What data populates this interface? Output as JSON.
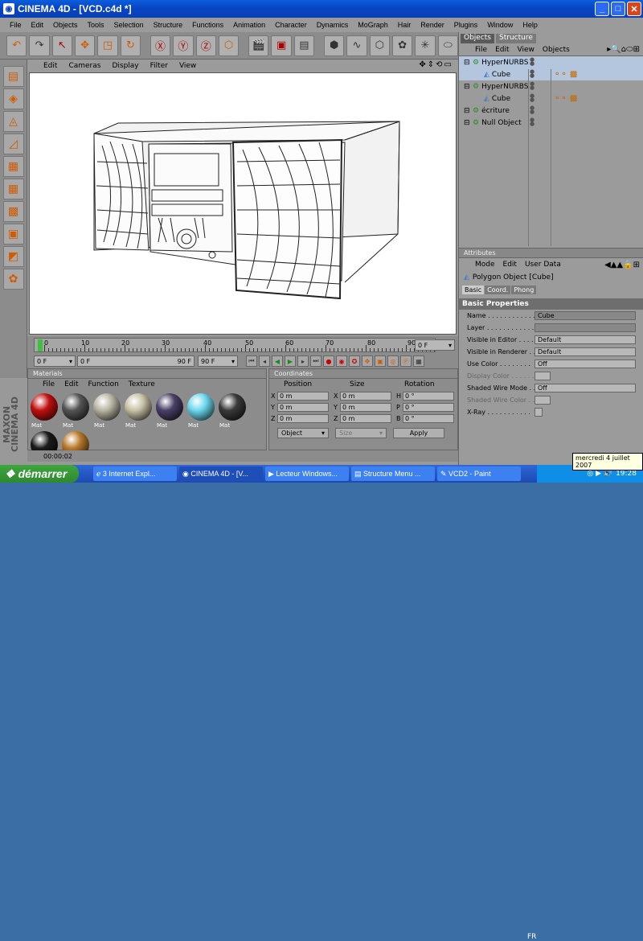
{
  "window": {
    "title": "CINEMA 4D - [VCD.c4d *]",
    "min": "_",
    "max": "□",
    "close": "✕"
  },
  "menu": [
    "File",
    "Edit",
    "Objects",
    "Tools",
    "Selection",
    "Structure",
    "Functions",
    "Animation",
    "Character",
    "Dynamics",
    "MoGraph",
    "Hair",
    "Render",
    "Plugins",
    "Window",
    "Help"
  ],
  "viewport_menu": [
    "Edit",
    "Cameras",
    "Display",
    "Filter",
    "View"
  ],
  "timeline": {
    "labels": [
      "0",
      "10",
      "20",
      "30",
      "40",
      "50",
      "60",
      "70",
      "80",
      "90"
    ],
    "current_frame": "0 F",
    "start_frame": "0 F",
    "end_field": "90 F",
    "min_field": "0 F",
    "max_field": "90 F"
  },
  "materials": {
    "header": "Materials",
    "menu": [
      "File",
      "Edit",
      "Function",
      "Texture"
    ],
    "items": [
      {
        "label": "Mat",
        "color": "#c01010"
      },
      {
        "label": "Mat",
        "color": "#555"
      },
      {
        "label": "Mat",
        "color": "#b9b5a3"
      },
      {
        "label": "Mat",
        "color": "#c7c2a6"
      },
      {
        "label": "Mat",
        "color": "#4a4066"
      },
      {
        "label": "Mat",
        "color": "#6cd8ee"
      },
      {
        "label": "Mat",
        "color": "#3a3a3a"
      },
      {
        "label": "",
        "color": "#1a1a1a"
      },
      {
        "label": "",
        "color": "#b87a2a"
      }
    ]
  },
  "coordinates": {
    "header": "Coordinates",
    "col_position": "Position",
    "col_size": "Size",
    "col_rotation": "Rotation",
    "rows": [
      {
        "axis": "X",
        "pos": "0 m",
        "sizeaxis": "X",
        "size": "0 m",
        "rotaxis": "H",
        "rot": "0 °"
      },
      {
        "axis": "Y",
        "pos": "0 m",
        "sizeaxis": "Y",
        "size": "0 m",
        "rotaxis": "P",
        "rot": "0 °"
      },
      {
        "axis": "Z",
        "pos": "0 m",
        "sizeaxis": "Z",
        "size": "0 m",
        "rotaxis": "B",
        "rot": "0 °"
      }
    ],
    "mode_select": "Object",
    "size_select": "Size",
    "apply": "Apply"
  },
  "status": "00:00:02",
  "maxon_label": "MAXON CINEMA 4D",
  "objects_panel": {
    "tabs": [
      "Objects",
      "Structure"
    ],
    "menu": [
      "File",
      "Edit",
      "View",
      "Objects"
    ],
    "items": [
      {
        "name": "HyperNURBS",
        "indent": 0,
        "selected": true,
        "icon": "⚙"
      },
      {
        "name": "Cube",
        "indent": 1,
        "selected": true,
        "icon": "◭"
      },
      {
        "name": "HyperNURBS",
        "indent": 0,
        "selected": false,
        "icon": "⚙"
      },
      {
        "name": "Cube",
        "indent": 1,
        "selected": false,
        "icon": "◭"
      },
      {
        "name": "écriture",
        "indent": 0,
        "selected": false,
        "icon": "⚙"
      },
      {
        "name": "Null Object",
        "indent": 0,
        "selected": false,
        "icon": "⚙"
      }
    ]
  },
  "attributes": {
    "header": "Attributes",
    "menu": [
      "Mode",
      "Edit",
      "User Data"
    ],
    "object": "Polygon Object [Cube]",
    "tabs": [
      "Basic",
      "Coord.",
      "Phong"
    ],
    "section": "Basic Properties",
    "rows": [
      {
        "label": "Name . . . . . . . . . . . .",
        "value": "Cube",
        "dim": false,
        "dark": true
      },
      {
        "label": "Layer . . . . . . . . . . . .",
        "value": "",
        "dim": false,
        "dark": true
      },
      {
        "label": "Visible in Editor . . . .",
        "value": "Default",
        "dim": false,
        "dark": false
      },
      {
        "label": "Visible in Renderer . .",
        "value": "Default",
        "dim": false,
        "dark": false
      },
      {
        "label": "Use Color . . . . . . . .",
        "value": "Off",
        "dim": false,
        "dark": false
      },
      {
        "label": "Display Color . . . . . .",
        "value": "",
        "dim": true,
        "dark": false
      },
      {
        "label": "Shaded Wire Mode . .",
        "value": "Off",
        "dim": false,
        "dark": false
      },
      {
        "label": "Shaded Wire Color . .",
        "value": "",
        "dim": true,
        "dark": false
      },
      {
        "label": "X-Ray . . . . . . . . . . .",
        "value": "",
        "dim": false,
        "dark": false
      }
    ]
  },
  "taskbar": {
    "start": "démarrer",
    "tasks": [
      "3 Internet Expl...",
      "CINEMA 4D - [V...",
      "Lecteur Windows...",
      "Structure Menu ...",
      "VCD2 - Paint"
    ],
    "lang": "FR",
    "time": "19:28",
    "tooltip": "mercredi 4 juillet 2007"
  }
}
